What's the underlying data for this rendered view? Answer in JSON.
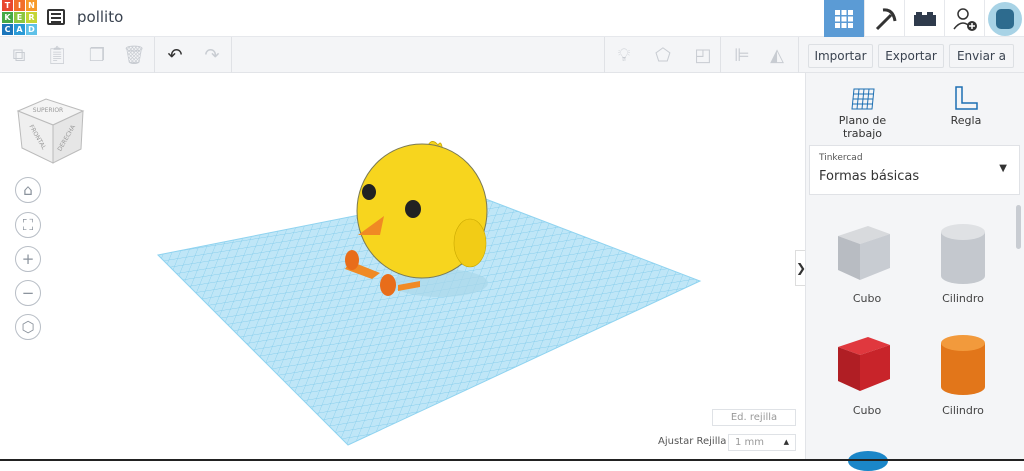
{
  "header": {
    "logo_letters": [
      "T",
      "I",
      "N",
      "K",
      "E",
      "R",
      "C",
      "A",
      "D"
    ],
    "project_title": "pollito"
  },
  "toolbar": {
    "import": "Importar",
    "export": "Exportar",
    "send": "Enviar a"
  },
  "viewcube": {
    "front": "FRONTAL",
    "right": "DERECHA",
    "top": "SUPERIOR"
  },
  "panel": {
    "workplane": "Plano de trabajo",
    "ruler": "Regla",
    "library_source": "Tinkercad",
    "library_name": "Formas básicas",
    "shapes": [
      {
        "label": "Cubo"
      },
      {
        "label": "Cilindro"
      },
      {
        "label": "Cubo"
      },
      {
        "label": "Cilindro"
      }
    ]
  },
  "grid": {
    "edit_grid": "Ed. rejilla",
    "snap_label": "Ajustar Rejilla",
    "snap_value": "1 mm"
  },
  "colors": {
    "accent": "#5b9bd5",
    "grid": "#8fd3f0",
    "chick": "#f7d51e",
    "beak": "#f08a24"
  }
}
